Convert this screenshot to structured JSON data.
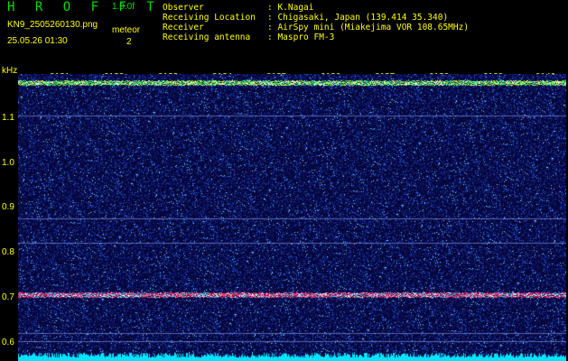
{
  "header": {
    "app_title": "H R O F F T",
    "version": "1.0.0f",
    "filename": "KN9_2505260130.png",
    "timestamp": "25.05.26 01:30",
    "meteor_label": "meteor",
    "meteor_count": "2"
  },
  "info": [
    {
      "key": "Observer",
      "value": ": K.Nagai"
    },
    {
      "key": "Receiving Location",
      "value": ": Chigasaki, Japan (139.414 35.340)"
    },
    {
      "key": "Receiver",
      "value": ": AirSpy mini (Miakejima VOR 108.65MHz)"
    },
    {
      "key": "Receiving antenna",
      "value": ": Maspro FM-3"
    }
  ],
  "axis": {
    "y_unit": "kHz",
    "y_ticks": [
      "1.1",
      "1.0",
      "0.9",
      "0.8",
      "0.7",
      "0.6"
    ],
    "x_ticks": [
      "0131",
      "0132",
      "0133",
      "0134",
      "0135",
      "0136",
      "0137",
      "0138",
      "0139",
      "0140"
    ]
  },
  "colors": {
    "background": "#07063a",
    "label": "#ffff00",
    "title": "#00dd00",
    "noise_floor": "#00e5ff",
    "carrier": "#ff3366"
  }
}
